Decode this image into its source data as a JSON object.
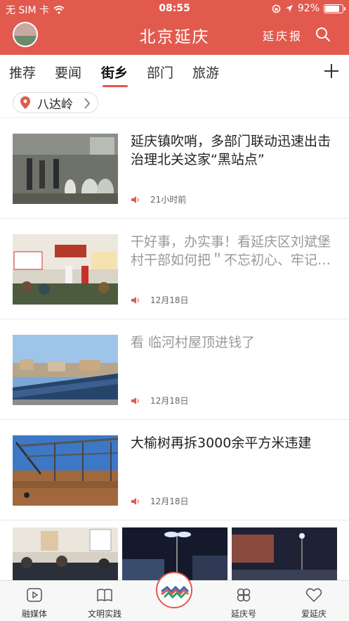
{
  "status": {
    "carrier": "无 SIM 卡",
    "time": "08:55",
    "battery": "92%",
    "battery_level": 0.92
  },
  "header": {
    "title": "北京延庆",
    "paper_label": "延庆报",
    "icons": [
      "avatar",
      "search-icon"
    ]
  },
  "tabs": {
    "items": [
      "推荐",
      "要闻",
      "街乡",
      "部门",
      "旅游"
    ],
    "active": "街乡"
  },
  "location": {
    "label": "八达岭"
  },
  "news": [
    {
      "headline": "延庆镇吹哨，多部门联动迅速出击治理北关这家“黑站点”",
      "time": "21小时前",
      "read": false
    },
    {
      "headline": "干好事，办实事！看延庆区刘斌堡村干部如何把＂不忘初心、牢记…",
      "time": "12月18日",
      "read": true
    },
    {
      "headline": "看 临河村屋顶进钱了",
      "time": "12月18日",
      "read": true
    },
    {
      "headline": "大榆树再拆3000余平方米违建",
      "time": "12月18日",
      "read": false
    }
  ],
  "bottom_nav": {
    "items": [
      "融媒体",
      "文明实践",
      "延庆号",
      "爱延庆"
    ],
    "accent": "#e25a4e"
  }
}
